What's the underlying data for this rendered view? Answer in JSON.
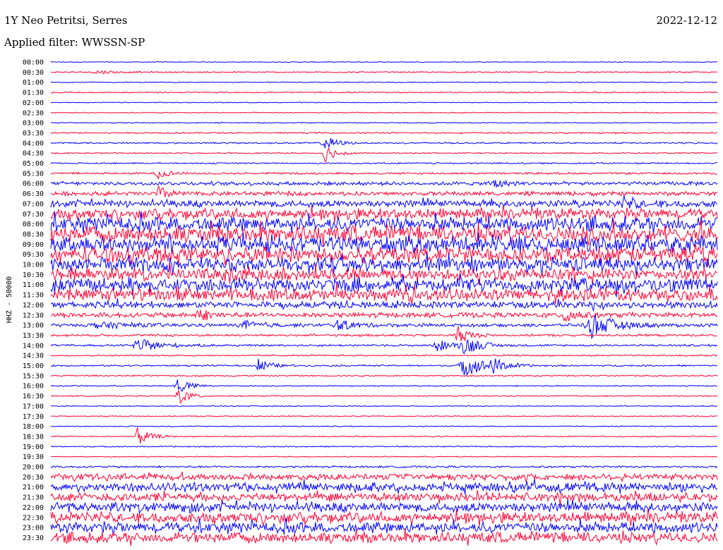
{
  "header": {
    "station": "1Y Neo Petritsi, Serres",
    "date": "2022-12-12",
    "filter": "Applied filter: WWSSN-SP"
  },
  "chart_data": {
    "type": "line",
    "title": "",
    "ylabel": "HHZ - 50000",
    "row_labels": [
      "00:00",
      "00:30",
      "01:00",
      "01:30",
      "02:00",
      "02:30",
      "03:00",
      "03:30",
      "04:00",
      "04:30",
      "05:00",
      "05:30",
      "06:00",
      "06:30",
      "07:00",
      "07:30",
      "08:00",
      "08:30",
      "09:00",
      "09:30",
      "10:00",
      "10:30",
      "11:00",
      "11:30",
      "12:00",
      "12:30",
      "13:00",
      "13:30",
      "14:00",
      "14:30",
      "15:00",
      "15:30",
      "16:00",
      "16:30",
      "17:00",
      "17:30",
      "18:00",
      "18:30",
      "19:00",
      "19:30",
      "20:00",
      "20:30",
      "21:00",
      "21:30",
      "22:00",
      "22:30",
      "23:00",
      "23:30"
    ],
    "row_noise_level": [
      0.5,
      0.7,
      0.6,
      0.8,
      0.5,
      0.6,
      0.6,
      0.9,
      0.9,
      0.7,
      0.9,
      1.2,
      2.2,
      2.5,
      4,
      6,
      8,
      9,
      9,
      9,
      8,
      7,
      8,
      7,
      4,
      3,
      2,
      1.4,
      1.2,
      0.9,
      1,
      0.8,
      0.7,
      0.7,
      0.6,
      0.6,
      0.6,
      0.7,
      0.7,
      0.6,
      1.2,
      3.5,
      5,
      5,
      5.5,
      6,
      6,
      6
    ],
    "series_colors": [
      "#0000ff",
      "#ff0033"
    ],
    "events": [
      {
        "row": 1,
        "x": 0.07,
        "amp": 3,
        "dur": 0.03
      },
      {
        "row": 8,
        "x": 0.41,
        "amp": 12,
        "dur": 0.02
      },
      {
        "row": 9,
        "x": 0.41,
        "amp": 14,
        "dur": 0.02
      },
      {
        "row": 11,
        "x": 0.16,
        "amp": 8,
        "dur": 0.02
      },
      {
        "row": 12,
        "x": 0.66,
        "amp": 9,
        "dur": 0.02
      },
      {
        "row": 13,
        "x": 0.16,
        "amp": 10,
        "dur": 0.02
      },
      {
        "row": 14,
        "x": 0.86,
        "amp": 10,
        "dur": 0.02
      },
      {
        "row": 25,
        "x": 0.22,
        "amp": 10,
        "dur": 0.02
      },
      {
        "row": 25,
        "x": 0.77,
        "amp": 14,
        "dur": 0.02
      },
      {
        "row": 26,
        "x": 0.07,
        "amp": 4,
        "dur": 0.06
      },
      {
        "row": 26,
        "x": 0.29,
        "amp": 6,
        "dur": 0.03
      },
      {
        "row": 26,
        "x": 0.43,
        "amp": 7,
        "dur": 0.03
      },
      {
        "row": 26,
        "x": 0.81,
        "amp": 18,
        "dur": 0.04
      },
      {
        "row": 27,
        "x": 0.61,
        "amp": 14,
        "dur": 0.02
      },
      {
        "row": 28,
        "x": 0.13,
        "amp": 10,
        "dur": 0.04
      },
      {
        "row": 28,
        "x": 0.58,
        "amp": 8,
        "dur": 0.03
      },
      {
        "row": 28,
        "x": 0.62,
        "amp": 12,
        "dur": 0.03
      },
      {
        "row": 30,
        "x": 0.31,
        "amp": 12,
        "dur": 0.02
      },
      {
        "row": 30,
        "x": 0.62,
        "amp": 16,
        "dur": 0.04
      },
      {
        "row": 30,
        "x": 0.66,
        "amp": 10,
        "dur": 0.02
      },
      {
        "row": 32,
        "x": 0.19,
        "amp": 14,
        "dur": 0.02
      },
      {
        "row": 33,
        "x": 0.19,
        "amp": 14,
        "dur": 0.02
      },
      {
        "row": 37,
        "x": 0.13,
        "amp": 14,
        "dur": 0.02
      }
    ]
  }
}
